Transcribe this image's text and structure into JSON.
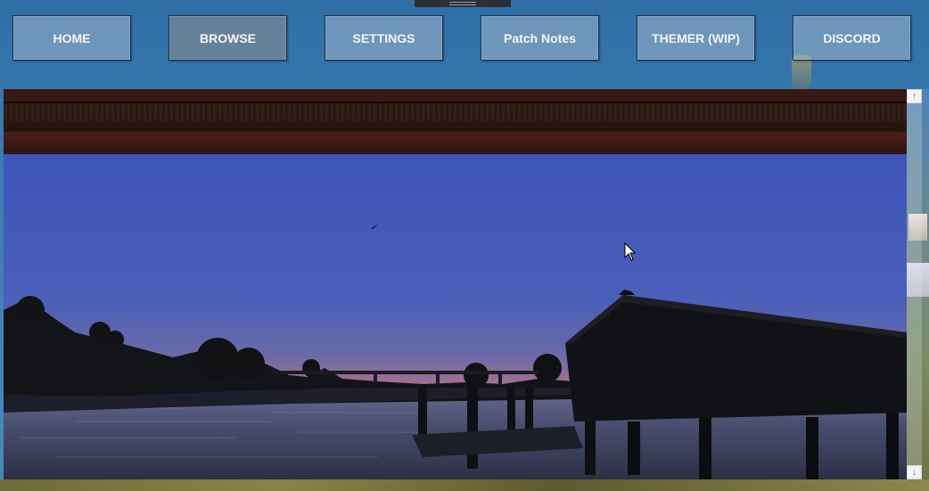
{
  "nav": {
    "buttons": [
      {
        "label": "HOME",
        "active": false
      },
      {
        "label": "BROWSE",
        "active": true
      },
      {
        "label": "SETTINGS",
        "active": false
      },
      {
        "label": "Patch Notes",
        "active": false
      },
      {
        "label": "THEMER (WIP)",
        "active": false
      },
      {
        "label": "DISCORD",
        "active": false
      }
    ]
  },
  "content": {
    "image_subject": "sunset-lake-boathouse-scene"
  },
  "scrollbar": {
    "up_icon": "arrow-up-icon",
    "down_icon": "arrow-down-icon",
    "up_glyph": "↑",
    "down_glyph": "↓"
  },
  "colors": {
    "sky_top": "#3d55b8",
    "sky_horizon": "#f07a4a",
    "nav_button": "#a0b4c8",
    "nav_active": "#78879a"
  }
}
